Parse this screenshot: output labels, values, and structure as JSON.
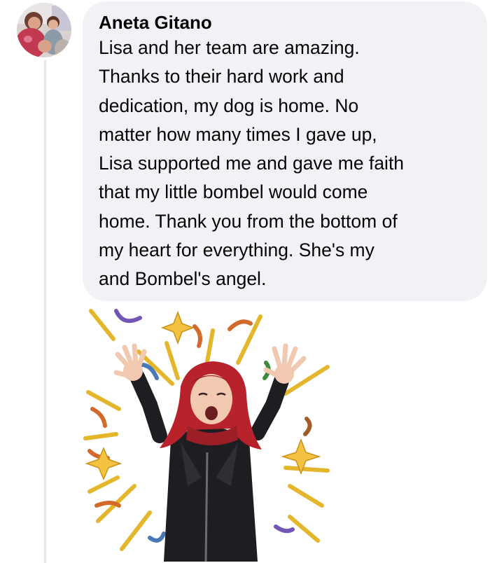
{
  "comment": {
    "author_name": "Aneta Gitano",
    "body_text": "Lisa and her team are amazing.\nThanks to their hard work and\ndedication, my dog is home. No\nmatter how many times I gave up,\nLisa supported me and gave me faith\nthat my little bombel would come\nhome. Thank you from the bottom of\nmy heart for everything. She's my\nand Bombel's angel."
  },
  "avatar": {
    "icon": "profile-photo-avatar"
  },
  "sticker": {
    "icon": "celebrating-avatar-sticker",
    "colors": {
      "hair": "#b8232b",
      "jacket": "#1d1d22",
      "confetti_gold": "#e3b62c",
      "confetti_purple": "#7355b5",
      "confetti_orange": "#d36a2a",
      "confetti_blue": "#4a78b8"
    }
  },
  "colors": {
    "bubble_background": "#f0f2f5",
    "thread_line": "#e4e6eb",
    "text": "#050505"
  }
}
